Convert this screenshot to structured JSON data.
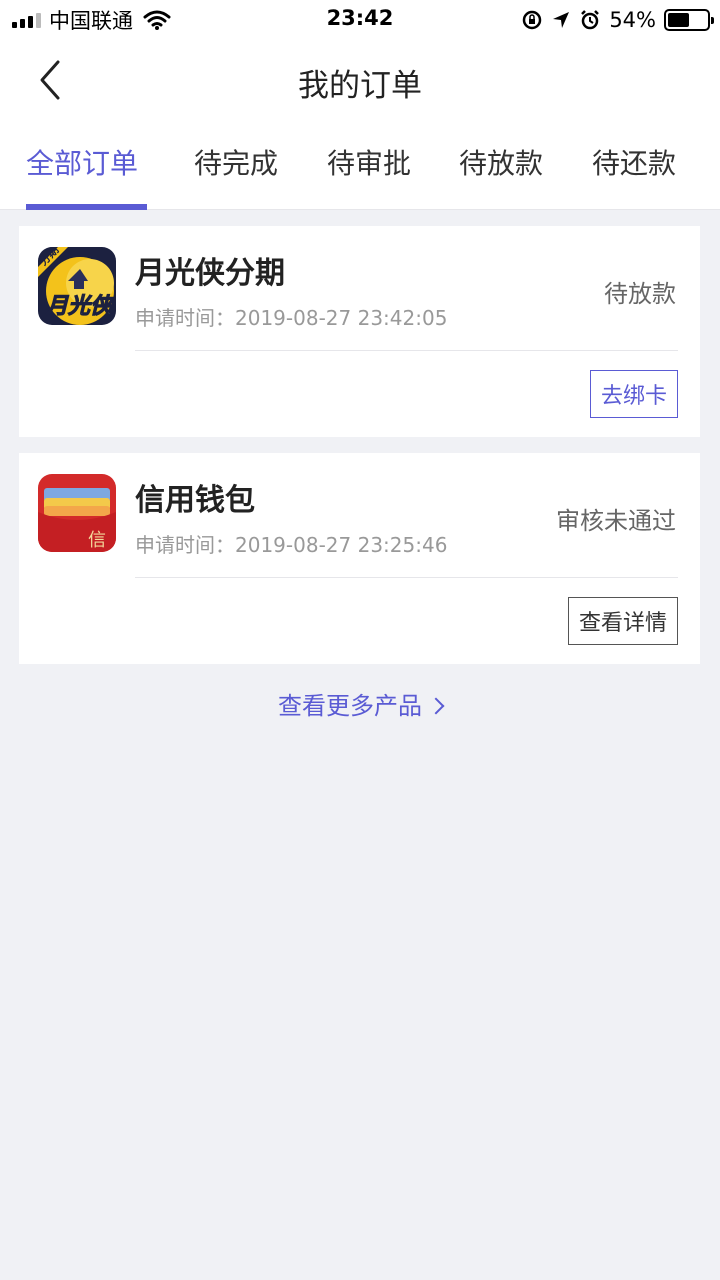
{
  "status_bar": {
    "carrier": "中国联通",
    "time": "23:42",
    "battery_percent_text": "54%",
    "battery_level": 0.54,
    "icons": [
      "signal-icon",
      "wifi-icon",
      "orientation-lock-icon",
      "location-icon",
      "alarm-icon",
      "battery-icon"
    ]
  },
  "header": {
    "title": "我的订单",
    "back_icon": "chevron-left-icon"
  },
  "tabs": [
    {
      "label": "全部订单",
      "active": true
    },
    {
      "label": "待完成",
      "active": false
    },
    {
      "label": "待审批",
      "active": false
    },
    {
      "label": "待放款",
      "active": false
    },
    {
      "label": "待还款",
      "active": false
    }
  ],
  "orders": [
    {
      "name": "月光侠分期",
      "logo_text": "月光侠",
      "logo_badge": "分期",
      "time_label": "申请时间：",
      "time": "2019-08-27 23:42:05",
      "status": "待放款",
      "action": "去绑卡"
    },
    {
      "name": "信用钱包",
      "logo_text": "信",
      "time_label": "申请时间：",
      "time": "2019-08-27 23:25:46",
      "status": "审核未通过",
      "action": "查看详情"
    }
  ],
  "more_link": "查看更多产品",
  "colors": {
    "accent": "#5a5bd4",
    "background": "#f0f1f5"
  }
}
